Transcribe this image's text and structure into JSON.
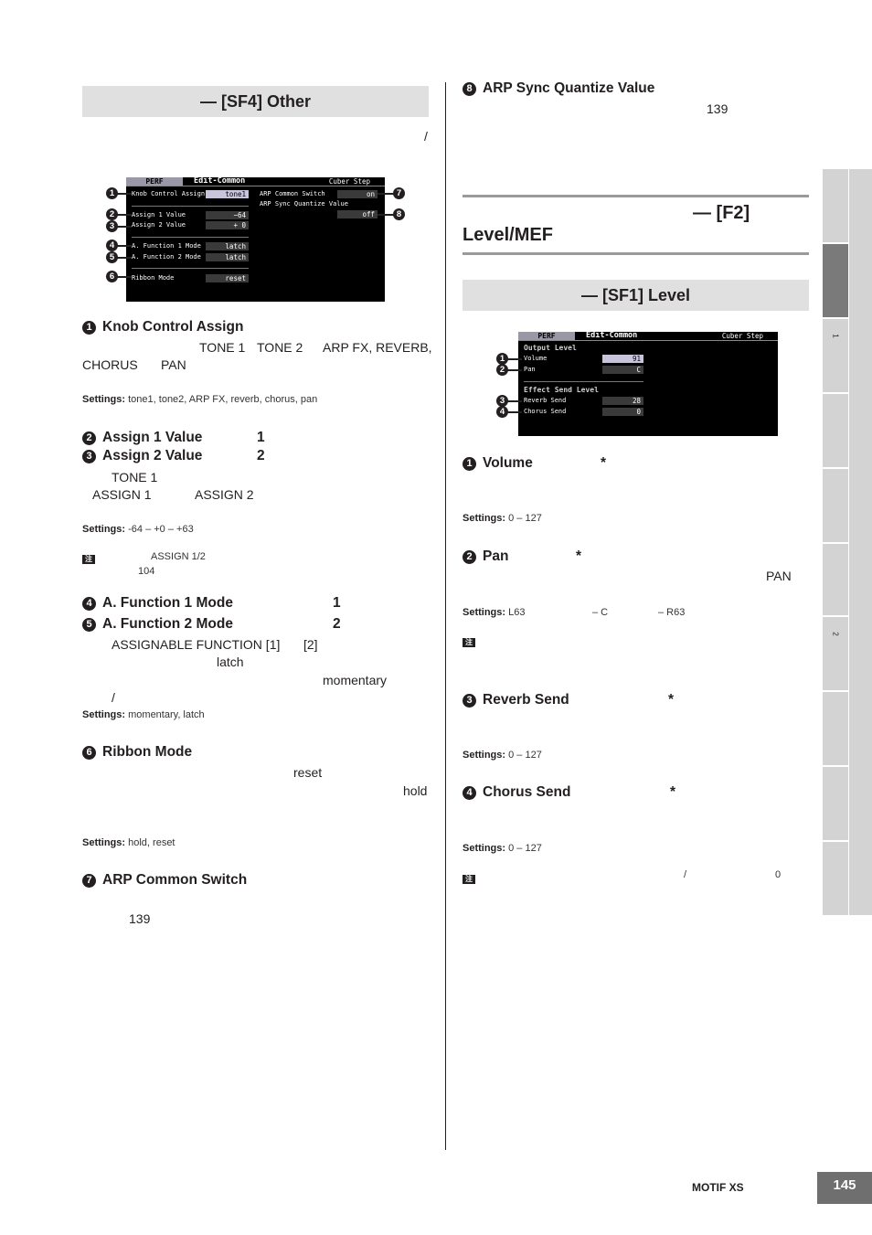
{
  "left": {
    "header": "— [SF4] Other",
    "slash": "/",
    "lcd": {
      "mode": "PERF",
      "page": "Edit-Common",
      "name": "Cuber Step",
      "rows": [
        {
          "label": "Knob Control Assign",
          "value": "tone1"
        },
        {
          "label": "Assign 1 Value",
          "value": "−64"
        },
        {
          "label": "Assign 2 Value",
          "value": "+ 0"
        },
        {
          "label": "A. Function 1 Mode",
          "value": "latch"
        },
        {
          "label": "A. Function 2 Mode",
          "value": "latch"
        },
        {
          "label": "Ribbon Mode",
          "value": "reset"
        }
      ],
      "right_rows": [
        {
          "label": "ARP Common Switch",
          "value": "on"
        },
        {
          "label": "ARP Sync Quantize Value",
          "value": "off"
        }
      ],
      "callouts": [
        "1",
        "2",
        "3",
        "4",
        "5",
        "6",
        "7",
        "8"
      ]
    },
    "knob": {
      "num": "1",
      "title": "Knob Control Assign",
      "w1": "TONE 1",
      "w2": "TONE 2",
      "w3": "ARP FX, REVERB,",
      "w4": "CHORUS",
      "w5": "PAN",
      "settings_label": "Settings:",
      "settings": "tone1, tone2, ARP FX, reverb, chorus, pan"
    },
    "assign": {
      "num1": "2",
      "title1": "Assign 1 Value",
      "n1": "1",
      "num2": "3",
      "title2": "Assign 2 Value",
      "n2": "2",
      "w1": "TONE 1",
      "w2": "ASSIGN 1",
      "w3": "ASSIGN 2",
      "settings_label": "Settings:",
      "settings": "-64 – +0 – +63",
      "note_icon": "注",
      "note1": "ASSIGN 1/2",
      "note2": "104"
    },
    "afunc": {
      "num1": "4",
      "title1": "A. Function 1 Mode",
      "n1": "1",
      "num2": "5",
      "title2": "A. Function 2 Mode",
      "n2": "2",
      "w1": "ASSIGNABLE FUNCTION [1]",
      "w2": "[2]",
      "w3": "latch",
      "w4": "momentary",
      "w5": "/",
      "settings_label": "Settings:",
      "settings": "momentary, latch"
    },
    "ribbon": {
      "num": "6",
      "title": "Ribbon Mode",
      "w1": "reset",
      "w2": "hold",
      "settings_label": "Settings:",
      "settings": "hold, reset"
    },
    "arp": {
      "num": "7",
      "title": "ARP Common Switch",
      "w1": "139"
    }
  },
  "right": {
    "sync": {
      "num": "8",
      "title": "ARP Sync Quantize Value",
      "w1": "139"
    },
    "chapter": {
      "a": "— [F2]",
      "b": "Level/MEF"
    },
    "header": "— [SF1] Level",
    "lcd": {
      "mode": "PERF",
      "page": "Edit-Common",
      "name": "Cuber Step",
      "h1": "Output Level",
      "h2": "Effect Send Level",
      "rows": [
        {
          "label": "Volume",
          "value": "91"
        },
        {
          "label": "Pan",
          "value": "C"
        },
        {
          "label": "Reverb Send",
          "value": "28"
        },
        {
          "label": "Chorus Send",
          "value": "0"
        }
      ],
      "callouts": [
        "1",
        "2",
        "3",
        "4"
      ]
    },
    "volume": {
      "num": "1",
      "title": "Volume",
      "star": "*",
      "settings_label": "Settings:",
      "settings": "0 – 127"
    },
    "pan": {
      "num": "2",
      "title": "Pan",
      "star": "*",
      "w1": "PAN",
      "settings_label": "Settings:",
      "s1": "L63",
      "s2": "– C",
      "s3": "– R63",
      "note_icon": "注"
    },
    "reverb": {
      "num": "3",
      "title": "Reverb Send",
      "star": "*",
      "settings_label": "Settings:",
      "settings": "0 – 127"
    },
    "chorus": {
      "num": "4",
      "title": "Chorus Send",
      "star": "*",
      "settings_label": "Settings:",
      "settings": "0 – 127",
      "note_icon": "注",
      "w1": "/",
      "w2": "0"
    }
  },
  "side_tabs": [
    "",
    "",
    "1",
    "",
    "",
    "",
    "2",
    "",
    "",
    ""
  ],
  "side_active": 1,
  "footer": {
    "product": "MOTIF XS",
    "page": "145"
  }
}
